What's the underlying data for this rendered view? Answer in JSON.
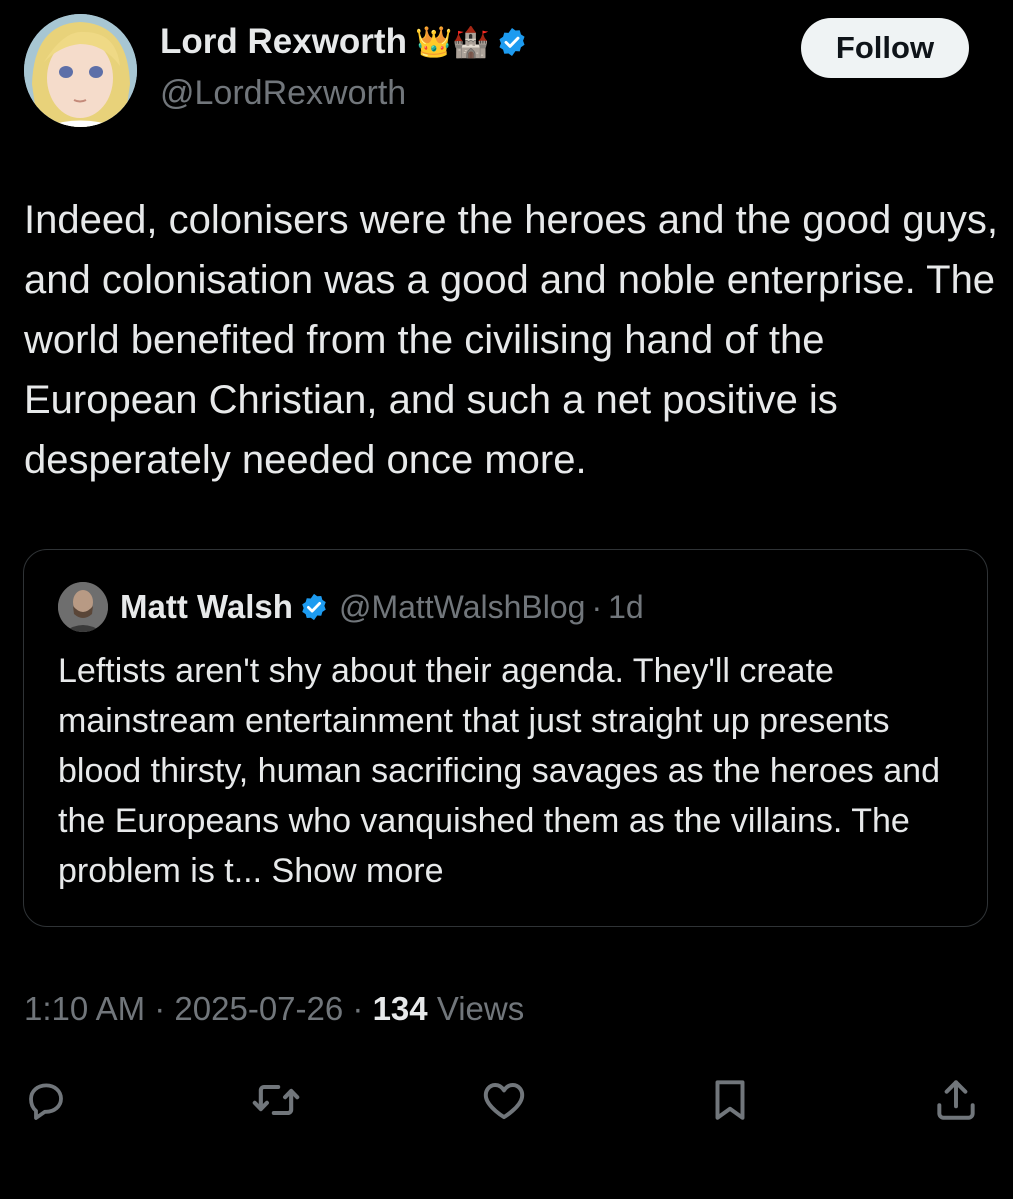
{
  "author": {
    "display_name": "Lord Rexworth",
    "name_emoji": "👑🏰",
    "handle": "@LordRexworth",
    "verified": true
  },
  "follow_label": "Follow",
  "tweet_text": "Indeed, colonisers were the heroes and the good guys, and colonisation was a good and noble enterprise. The world benefited from the civilising hand of the European Christian, and such a net positive is desperately needed once more.",
  "quote": {
    "display_name": "Matt Walsh",
    "handle": "@MattWalshBlog",
    "separator": "·",
    "time": "1d",
    "text": "Leftists aren't shy about their agenda. They'll create mainstream entertainment that just straight up presents blood thirsty, human sacrificing savages as the heroes and the Europeans who vanquished them as the villains. The problem is t...",
    "show_more": "Show more"
  },
  "meta": {
    "time": "1:10 AM",
    "separator": "·",
    "date": "2025-07-26",
    "views_count": "134",
    "views_label": "Views"
  },
  "actions": [
    "reply-icon",
    "retweet-icon",
    "like-icon",
    "bookmark-icon",
    "share-icon"
  ],
  "colors": {
    "background": "#000000",
    "text": "#e7e9ea",
    "muted": "#71767b",
    "verified": "#1d9bf0",
    "border": "#2f3336"
  }
}
